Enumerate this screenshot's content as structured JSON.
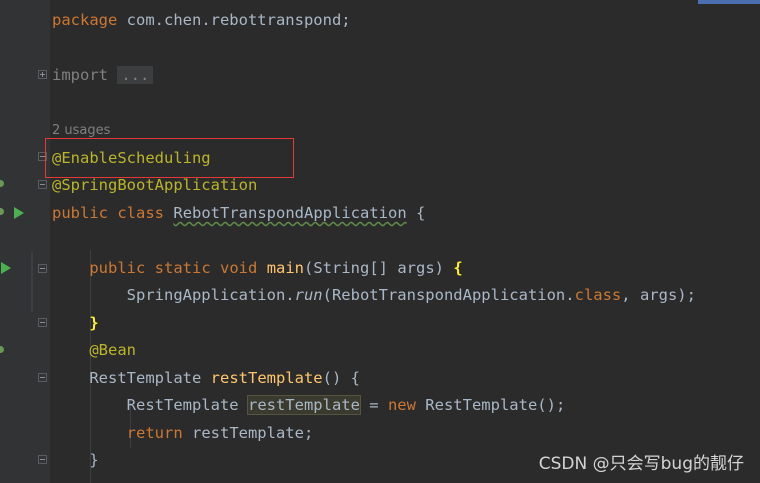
{
  "editor": {
    "package_kw": "package",
    "package_name": " com.chen.rebottranspond;",
    "import_kw": "import",
    "import_fold": "...",
    "usages": "2 usages",
    "anno_scheduling": "@EnableScheduling",
    "anno_springboot": "@SpringBootApplication",
    "class_public": "public",
    "class_kw": "class",
    "class_name": "RebotTranspondApplication",
    "class_open": " {",
    "main_public": "public",
    "main_static": "static",
    "main_void": "void",
    "main_name": "main",
    "main_params": "(String[] args) ",
    "main_open": "{",
    "run_prefix": "SpringApplication.",
    "run_method": "run",
    "run_args_a": "(RebotTranspondApplication.",
    "run_class_kw": "class",
    "run_args_b": ", args);",
    "main_close": "}",
    "anno_bean": "@Bean",
    "rt_type": "RestTemplate ",
    "rt_method": "restTemplate",
    "rt_params": "() {",
    "var_type": "RestTemplate ",
    "var_name": "restTemplate",
    "var_assign": " = ",
    "new_kw": "new",
    "var_ctor": " RestTemplate();",
    "return_kw": "return",
    "return_val": " restTemplate;",
    "method_close": "}"
  },
  "watermark": "CSDN @只会写bug的靓仔",
  "colors": {
    "background": "#2b2b2b",
    "keyword": "#cc7832",
    "annotation": "#bbb529",
    "method": "#ffc66d",
    "text": "#a9b7c6",
    "highlight_box": "#e53935",
    "run_icon": "#4caf50"
  },
  "icons": [
    "run-icon",
    "bean-icon",
    "fold-icon"
  ]
}
